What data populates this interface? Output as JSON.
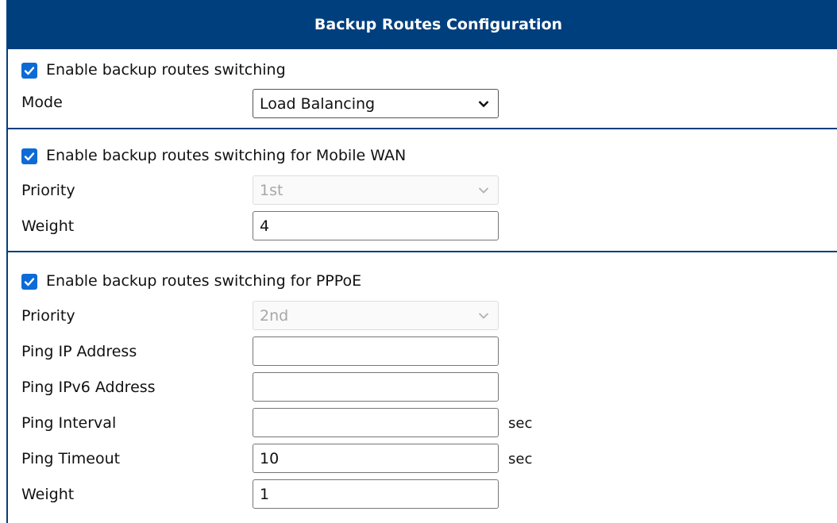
{
  "header": {
    "title": "Backup Routes Configuration"
  },
  "general": {
    "enable_label": "Enable backup routes switching",
    "enable_checked": true,
    "mode_label": "Mode",
    "mode_value": "Load Balancing"
  },
  "mobile_wan": {
    "enable_label": "Enable backup routes switching for Mobile WAN",
    "enable_checked": true,
    "priority_label": "Priority",
    "priority_value": "1st",
    "weight_label": "Weight",
    "weight_value": "4"
  },
  "pppoe": {
    "enable_label": "Enable backup routes switching for PPPoE",
    "enable_checked": true,
    "priority_label": "Priority",
    "priority_value": "2nd",
    "ping_ip_label": "Ping IP Address",
    "ping_ip_value": "",
    "ping_ipv6_label": "Ping IPv6 Address",
    "ping_ipv6_value": "",
    "ping_interval_label": "Ping Interval",
    "ping_interval_value": "",
    "ping_interval_unit": "sec",
    "ping_timeout_label": "Ping Timeout",
    "ping_timeout_value": "10",
    "ping_timeout_unit": "sec",
    "weight_label": "Weight",
    "weight_value": "1"
  },
  "colors": {
    "header_bg": "#003f7d",
    "checkbox_accent": "#0c6bd6",
    "disabled_text": "#a7a7a7"
  }
}
